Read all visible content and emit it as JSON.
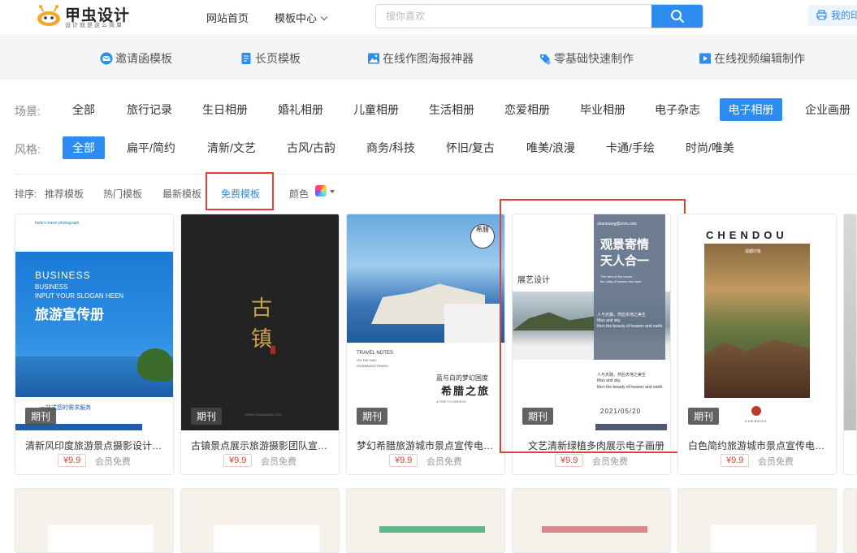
{
  "header": {
    "brand": "甲虫设计",
    "slogan": "设计就是这么简单",
    "nav_home": "网站首页",
    "nav_templates": "模板中心",
    "search_placeholder": "搜你喜欢",
    "my_print": "我的印"
  },
  "features": [
    {
      "label": "邀请函模板",
      "icon": "envelope-icon"
    },
    {
      "label": "长页模板",
      "icon": "document-icon"
    },
    {
      "label": "在线作图海报神器",
      "icon": "image-icon"
    },
    {
      "label": "零基础快速制作",
      "icon": "palette-icon"
    },
    {
      "label": "在线视频编辑制作",
      "icon": "video-icon"
    }
  ],
  "scene": {
    "label": "场景:",
    "items": [
      "全部",
      "旅行记录",
      "生日相册",
      "婚礼相册",
      "儿童相册",
      "生活相册",
      "恋爱相册",
      "毕业相册",
      "电子杂志",
      "电子相册",
      "企业画册"
    ],
    "active": "电子相册"
  },
  "style": {
    "label": "风格:",
    "items": [
      "全部",
      "扁平/简约",
      "清新/文艺",
      "古风/古韵",
      "商务/科技",
      "怀旧/复古",
      "唯美/浪漫",
      "卡通/手绘",
      "时尚/唯美"
    ],
    "active": "全部"
  },
  "sort": {
    "label": "排序:",
    "items": [
      "推荐模板",
      "热门模板",
      "最新模板",
      "免费模板"
    ],
    "active": "免费模板",
    "color_label": "颜色"
  },
  "cards": [
    {
      "title": "清新风印度旅游景点摄影设计宣传册",
      "tag": "期刊",
      "price": "¥9.9",
      "member": "会员免费",
      "thumb": {
        "small": "hello's travel photograph",
        "h1": "BUSINESS",
        "h2": "BUSINESS",
        "h3": "INPUT YOUR SLOGAN HEEN",
        "main": "旅游宣传册",
        "bottom": "一站式您的需求服务"
      }
    },
    {
      "title": "古镇景点展示旅游摄影团队宣传画册",
      "tag": "期刊",
      "price": "¥9.9",
      "member": "会员免费",
      "thumb": {
        "main1": "古",
        "main2": "镇",
        "bottom": "WWW.ZHANMANG.COM"
      }
    },
    {
      "title": "梦幻希腊旅游城市景点宣传电子画册",
      "tag": "期刊",
      "price": "¥9.9",
      "member": "会员免费",
      "thumb": {
        "circle": "希腊",
        "t1": "TRAVEL NOTES",
        "t2": "ON THE WAY",
        "t3": "ZHANMANG/TRAVEL",
        "sub": "蓝与白的梦幻国度",
        "main": "希腊之旅",
        "foot": "A TRIP TO GREECE"
      }
    },
    {
      "title": "文艺清新绿植多肉展示电子画册",
      "tag": "期刊",
      "price": "¥9.9",
      "member": "会员免费",
      "thumb": {
        "email": "zhanmang@znm.com",
        "h1": "观景寄情",
        "h2": "天人合一",
        "side": "展艺设计",
        "p1": "The view of the scene,",
        "p2": "the unity of heaven and man.",
        "q1": "人与天融，然后天地之美生",
        "q2": "Man and sky,",
        "q3": "then the beauty of heaven and earth.",
        "date": "2021/05/20"
      }
    },
    {
      "title": "白色简约旅游城市景点宣传电子画册",
      "tag": "期刊",
      "price": "¥9.9",
      "member": "会员免费",
      "thumb": {
        "top": "CHENDOU",
        "sub": "成都印象",
        "bottom": "CHENDOU"
      }
    }
  ],
  "colors": {
    "accent": "#2d8cf0",
    "highlight": "#e0403a"
  }
}
